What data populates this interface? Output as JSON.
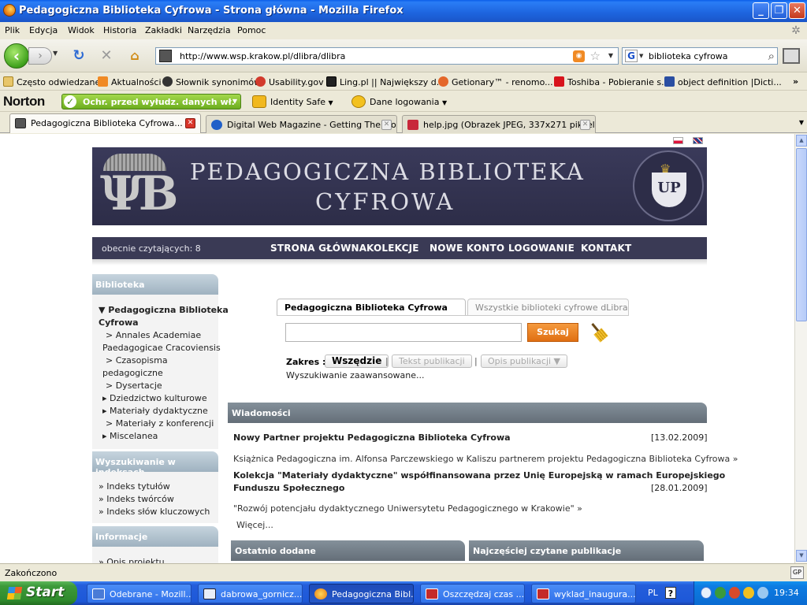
{
  "window": {
    "title": "Pedagogiczna Biblioteka Cyfrowa - Strona główna - Mozilla Firefox",
    "minimize": "_",
    "restore": "❐",
    "close": "✕"
  },
  "menu": [
    "Plik",
    "Edycja",
    "Widok",
    "Historia",
    "Zakładki",
    "Narzędzia",
    "Pomoc"
  ],
  "nav": {
    "url": "http://www.wsp.krakow.pl/dlibra/dlibra",
    "search_value": "biblioteka cyfrowa",
    "search_engine_letter": "G"
  },
  "bookmarks": [
    "Często odwiedzane",
    "Aktualności",
    "Słownik synonimów",
    "Usability.gov",
    "Ling.pl || Największy d...",
    "Getionary™ - renomo...",
    "Toshiba - Pobieranie s...",
    "object definition |Dicti..."
  ],
  "bookmarks_more": "»",
  "norton": {
    "logo": "Norton",
    "status": "Ochr. przed wyłudz. danych wł.",
    "identity": "Identity Safe",
    "logins": "Dane logowania"
  },
  "tabs": [
    {
      "label": "Pedagogiczna Biblioteka Cyfrowa..."
    },
    {
      "label": "Digital Web Magazine - Getting The Mo..."
    },
    {
      "label": "help.jpg (Obrazek JPEG, 337x271 pikseli)"
    }
  ],
  "page": {
    "banner_line1": "PEDAGOGICZNA BIBLIOTEKA",
    "banner_line2": "CYFROWA",
    "logo_letters": "ΨB",
    "seal_letters": "UP",
    "readers": "obecnie czytających: 8",
    "topnav": [
      "STRONA GŁÓWNA",
      "KOLEKCJE",
      "NOWE KONTO",
      "LOGOWANIE",
      "KONTAKT"
    ],
    "sidebar": {
      "biblioteka_heading": "Biblioteka",
      "root_line1": "Pedagogiczna Biblioteka",
      "root_line2": "Cyfrowa",
      "items": [
        "> Annales Academiae",
        "Paedagogicae Cracoviensis",
        "> Czasopisma",
        "pedagogiczne",
        "> Dysertacje",
        "Dziedzictwo kulturowe",
        "Materiały dydaktyczne",
        "> Materiały z konferencji",
        "Miscelanea"
      ],
      "index_heading": "Wyszukiwanie w indeksach",
      "index_items": [
        "Indeks tytułów",
        "Indeks twórców",
        "Indeks słów kluczowych"
      ],
      "info_heading": "Informacje",
      "info_items": [
        "Opis projektu"
      ]
    },
    "search": {
      "tab_active": "Pedagogiczna Biblioteka Cyfrowa",
      "tab_inactive": "Wszystkie biblioteki cyfrowe dLibra",
      "button": "Szukaj",
      "scope_label": "Zakres :",
      "scope_all": "Wszędzie",
      "scope_text": "Tekst publikacji",
      "scope_desc": "Opis publikacji ▼",
      "advanced": "Wyszukiwanie zaawansowane..."
    },
    "news": {
      "heading": "Wiadomości",
      "items": [
        {
          "title": "Nowy Partner projektu Pedagogiczna Biblioteka Cyfrowa",
          "date": "[13.02.2009]",
          "text": "Książnica Pedagogiczna im. Alfonsa Parczewskiego w Kaliszu partnerem projektu Pedagogiczna Biblioteka Cyfrowa  »"
        },
        {
          "title_line1": "Kolekcja \"Materiały dydaktyczne\" współfinansowana przez Unię Europejską w ramach Europejskiego",
          "title_line2": "Funduszu Społecznego",
          "date": "[28.01.2009]",
          "text": "\"Rozwój potencjału dydaktycznego Uniwersytetu Pedagogicznego w Krakowie\"  »"
        }
      ],
      "more": "Więcej..."
    },
    "recent_heading": "Ostatnio dodane",
    "popular_heading": "Najczęściej czytane publikacje"
  },
  "statusbar": {
    "text": "Zakończono",
    "gp": "GP"
  },
  "taskbar": {
    "start": "Start",
    "tasks": [
      "Odebrane - Mozill...",
      "dabrowa_gornicz...",
      "Pedagogiczna Bibl...",
      "Oszczędzaj czas ...",
      "wyklad_inaugura..."
    ],
    "lang": "PL",
    "help": "?",
    "time": "19:34"
  }
}
